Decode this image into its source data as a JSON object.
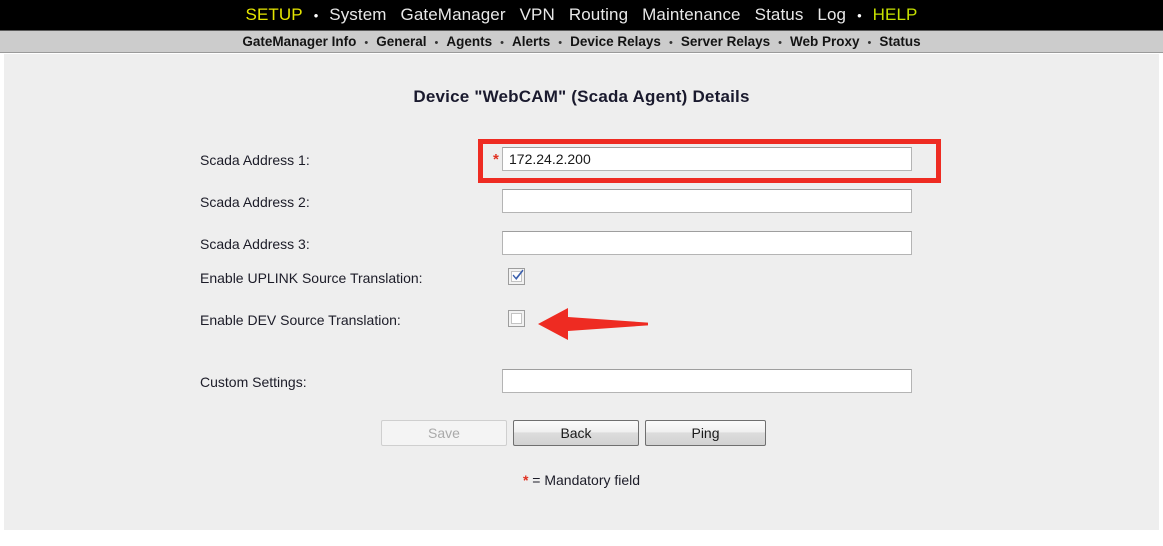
{
  "topnav": {
    "items": [
      {
        "label": "SETUP",
        "style": "accent"
      },
      {
        "label": "•",
        "style": "sep"
      },
      {
        "label": "System",
        "style": "normal"
      },
      {
        "label": "GateManager",
        "style": "normal"
      },
      {
        "label": "VPN",
        "style": "normal"
      },
      {
        "label": "Routing",
        "style": "normal"
      },
      {
        "label": "Maintenance",
        "style": "normal"
      },
      {
        "label": "Status",
        "style": "normal"
      },
      {
        "label": "Log",
        "style": "normal"
      },
      {
        "label": "•",
        "style": "sep"
      },
      {
        "label": "HELP",
        "style": "help"
      }
    ]
  },
  "subnav": {
    "items": [
      {
        "label": "GateManager Info"
      },
      {
        "label": "General"
      },
      {
        "label": "Agents"
      },
      {
        "label": "Alerts"
      },
      {
        "label": "Device Relays"
      },
      {
        "label": "Server Relays"
      },
      {
        "label": "Web Proxy"
      },
      {
        "label": "Status"
      }
    ],
    "separator": "•"
  },
  "page": {
    "title": "Device \"WebCAM\" (Scada Agent) Details"
  },
  "form": {
    "scada1": {
      "label": "Scada Address 1:",
      "value": "172.24.2.200",
      "placeholder": "",
      "mandatory_marker": "*"
    },
    "scada2": {
      "label": "Scada Address 2:",
      "value": "",
      "placeholder": ""
    },
    "scada3": {
      "label": "Scada Address 3:",
      "value": "",
      "placeholder": ""
    },
    "uplink": {
      "label": "Enable UPLINK Source Translation:",
      "checked": true
    },
    "dev": {
      "label": "Enable DEV Source Translation:",
      "checked": false
    },
    "custom": {
      "label": "Custom Settings:",
      "value": "",
      "placeholder": ""
    }
  },
  "buttons": {
    "save": {
      "label": "Save",
      "state": "disabled"
    },
    "back": {
      "label": "Back",
      "state": "enabled"
    },
    "ping": {
      "label": "Ping",
      "state": "enabled"
    }
  },
  "footer": {
    "mandatory_marker": "*",
    "mandatory_text": " = Mandatory field"
  },
  "annotations": {
    "highlight_box": {
      "name": "red-highlight-rectangle",
      "color": "#ee2b22"
    },
    "pointer_arrow": {
      "name": "red-arrow-pointer",
      "color": "#ee2b22",
      "direction": "left"
    }
  },
  "colors": {
    "topnav_bg": "#000000",
    "topnav_accent": "#e5e500",
    "topnav_help": "#c6e000",
    "subnav_bg": "#cccccc",
    "content_bg": "#eeeeee",
    "highlight_red": "#ee2b22",
    "mandatory_red": "#e03020",
    "check_blue": "#3b5fad"
  }
}
